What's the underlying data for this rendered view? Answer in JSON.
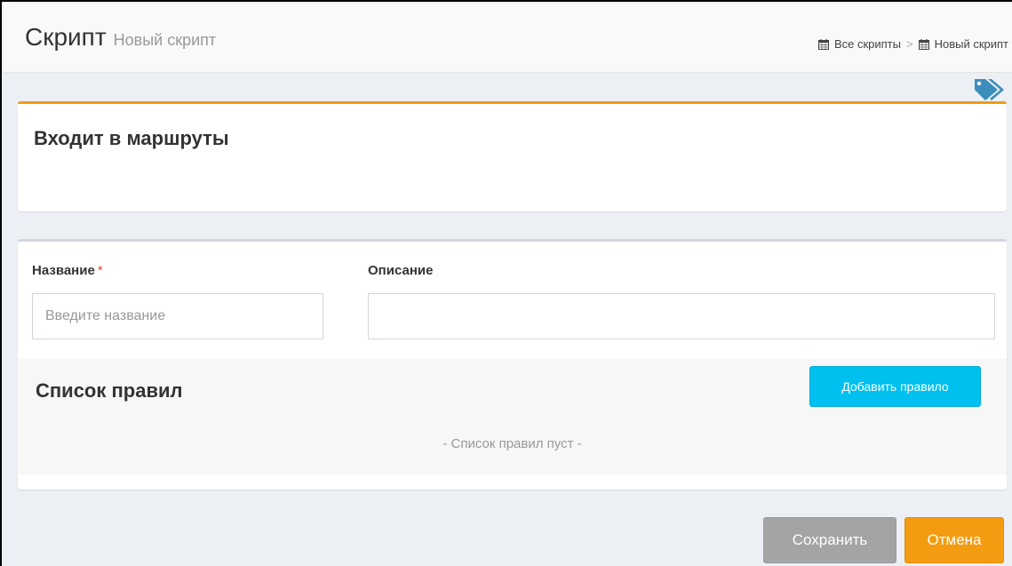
{
  "header": {
    "title": "Скрипт",
    "subtitle": "Новый скрипт",
    "breadcrumb": {
      "all_scripts": "Все скрипты",
      "separator": ">",
      "current": "Новый скрипт"
    }
  },
  "routes_box": {
    "title": "Входит в маршруты",
    "accent_color": "#f39c12"
  },
  "form": {
    "name_label": "Название",
    "required_mark": "*",
    "name_value": "",
    "name_placeholder": "Введите название",
    "description_label": "Описание",
    "description_value": "",
    "description_placeholder": ""
  },
  "rules": {
    "title": "Список правил",
    "add_button": "Добавить правило",
    "empty_text": "- Список правил пуст -"
  },
  "actions": {
    "save": "Сохранить",
    "cancel": "Отмена"
  },
  "colors": {
    "info": "#00c0ef",
    "warning": "#f39c12",
    "disabled": "#a4a4a4",
    "tag_icon": "#3c8dbc"
  },
  "icons": {
    "breadcrumb": "calendar-icon",
    "tags": "tags-icon"
  }
}
